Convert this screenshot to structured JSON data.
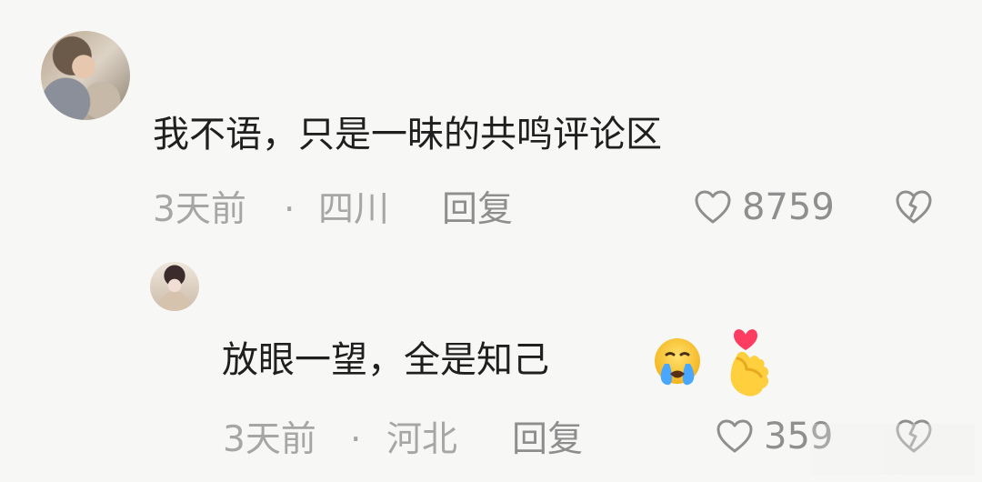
{
  "comments": [
    {
      "text": "我不语，只是一昧的共鸣评论区",
      "meta_time": "3天前",
      "meta_sep": "·",
      "meta_location": "四川",
      "reply": "回复",
      "likes": "8759",
      "avatar_icon": "avatar-image"
    },
    {
      "text": "放眼一望，全是知己",
      "meta_time": "3天前",
      "meta_sep": "·",
      "meta_location": "河北",
      "reply": "回复",
      "likes": "359",
      "avatar_icon": "avatar-image",
      "emoji_icons": [
        "crying-face-icon",
        "finger-heart-icon"
      ]
    }
  ],
  "icons": {
    "like": "heart-outline-icon",
    "dislike": "broken-heart-outline-icon"
  },
  "colors": {
    "background": "#f7f7f5",
    "text": "#1f1f1f",
    "meta": "#a6a6a6",
    "reply": "#8e8e8e"
  }
}
